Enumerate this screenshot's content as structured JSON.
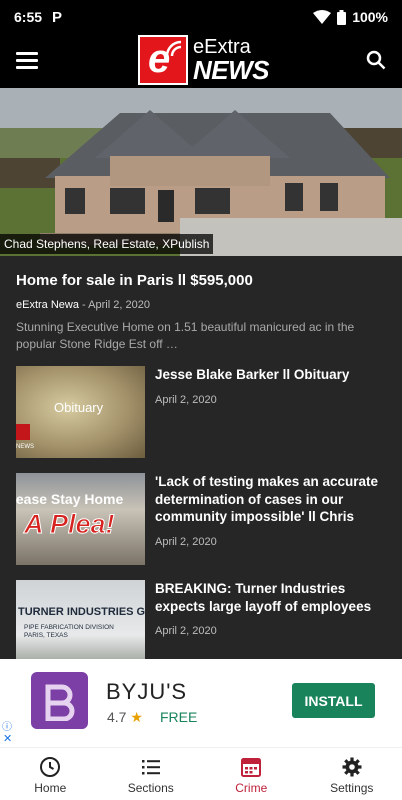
{
  "status_bar": {
    "time": "6:55",
    "battery": "100%"
  },
  "app_bar": {
    "logo_line1": "eExtra",
    "logo_line2": "NEWS"
  },
  "hero": {
    "caption": "Chad Stephens, Real Estate, XPublish"
  },
  "featured": {
    "title": "Home for sale in Paris ll $595,000",
    "author": "eExtra Newa",
    "date": "April 2, 2020",
    "excerpt": "Stunning Executive Home on 1.51 beautiful manicured ac in the popular Stone Ridge Est off …"
  },
  "articles": [
    {
      "title": "Jesse Blake Barker ll Obituary",
      "date": "April 2, 2020",
      "thumb_text": "Obituary"
    },
    {
      "title": "'Lack of testing makes an accurate determination of cases in our community impossible' ll Chris",
      "date": "April 2, 2020",
      "thumb_text_1": "lease Stay Home",
      "thumb_text_2": "A Plea!"
    },
    {
      "title": "BREAKING: Turner Industries expects large layoff of employees",
      "date": "April 2, 2020",
      "thumb_text_1": "TURNER INDUSTRIES GROUP",
      "thumb_text_2": "PIPE FABRICATION DIVISION",
      "thumb_text_3": "PARIS, TEXAS"
    }
  ],
  "ad": {
    "name": "BYJU'S",
    "rating": "4.7",
    "price": "FREE",
    "install_label": "INSTALL",
    "brand_color": "#7b3fa6"
  },
  "bottom_nav": [
    {
      "label": "Home",
      "icon": "clock-icon"
    },
    {
      "label": "Sections",
      "icon": "list-icon"
    },
    {
      "label": "Crime",
      "icon": "calendar-icon",
      "active": true
    },
    {
      "label": "Settings",
      "icon": "gear-icon"
    }
  ],
  "colors": {
    "accent": "#c0213a",
    "logo_red": "#e3161b",
    "install_green": "#19845b",
    "content_bg": "#262626"
  }
}
